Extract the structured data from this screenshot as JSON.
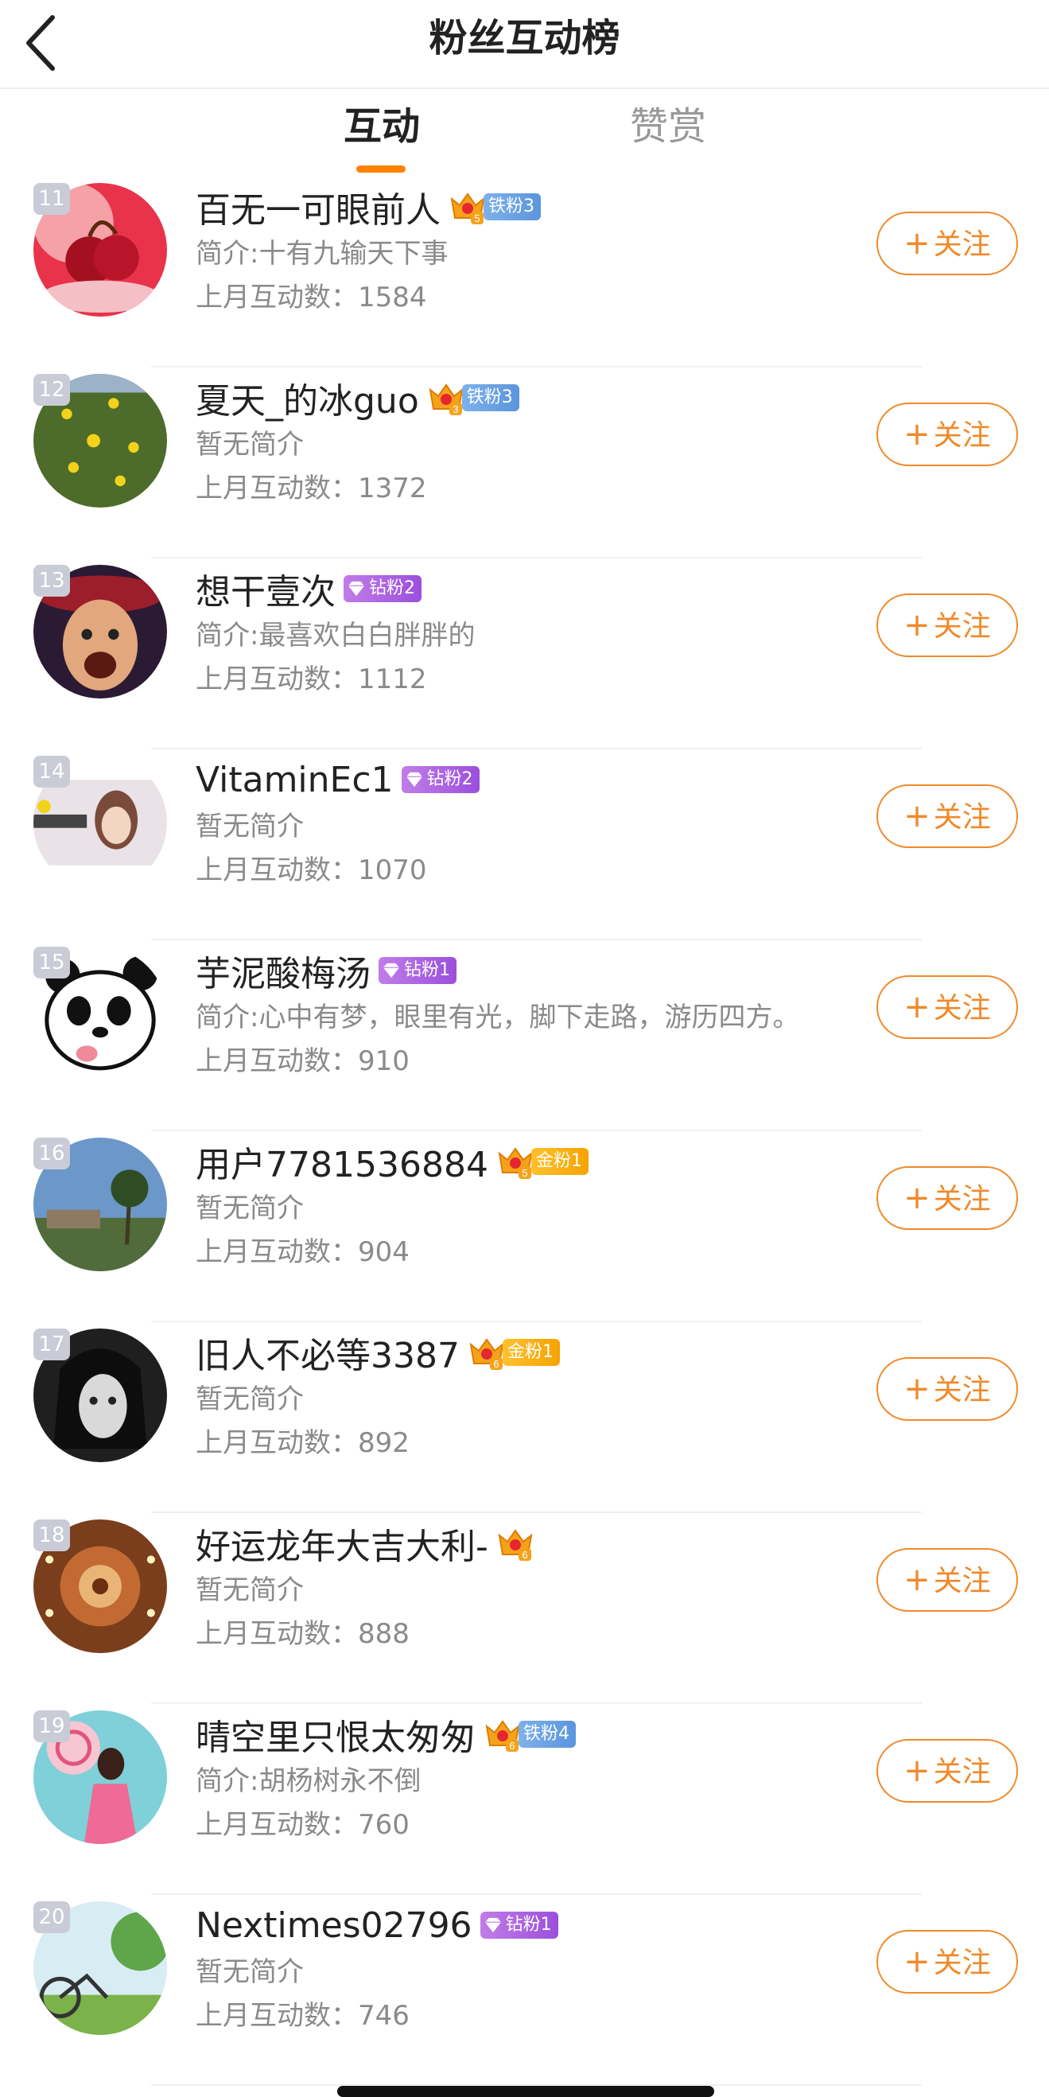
{
  "header": {
    "title": "粉丝互动榜"
  },
  "tabs": [
    {
      "label": "互动",
      "active": true
    },
    {
      "label": "赞赏",
      "active": false
    }
  ],
  "colors": {
    "accent": "#ff8200",
    "follow": "#f0892a",
    "iron_badge": "#6aa3e4",
    "gold_badge": "#fbb318",
    "diamond_badge": "#ad63e2"
  },
  "users": [
    {
      "rank": "11",
      "name": "百无一可眼前人",
      "crown_level": "5",
      "badge": "铁粉3",
      "badge_type": "iron",
      "intro": "简介:十有九输天下事",
      "stat": "上月互动数：1584",
      "follow": "关注"
    },
    {
      "rank": "12",
      "name": "夏天_的冰guo",
      "crown_level": "3",
      "badge": "铁粉3",
      "badge_type": "iron",
      "intro": "暂无简介",
      "stat": "上月互动数：1372",
      "follow": "关注"
    },
    {
      "rank": "13",
      "name": "想干壹次",
      "crown_level": "",
      "badge": "钻粉2",
      "badge_type": "diamond",
      "intro": "简介:最喜欢白白胖胖的",
      "stat": "上月互动数：1112",
      "follow": "关注"
    },
    {
      "rank": "14",
      "name": "VitaminEc1",
      "crown_level": "",
      "badge": "钻粉2",
      "badge_type": "diamond",
      "intro": "暂无简介",
      "stat": "上月互动数：1070",
      "follow": "关注"
    },
    {
      "rank": "15",
      "name": "芋泥酸梅汤",
      "crown_level": "",
      "badge": "钻粉1",
      "badge_type": "diamond",
      "intro": "简介:心中有梦，眼里有光，脚下走路，游历四方。",
      "stat": "上月互动数：910",
      "follow": "关注"
    },
    {
      "rank": "16",
      "name": "用户7781536884",
      "crown_level": "5",
      "badge": "金粉1",
      "badge_type": "gold",
      "intro": "暂无简介",
      "stat": "上月互动数：904",
      "follow": "关注"
    },
    {
      "rank": "17",
      "name": "旧人不必等3387",
      "crown_level": "6",
      "badge": "金粉1",
      "badge_type": "gold",
      "intro": "暂无简介",
      "stat": "上月互动数：892",
      "follow": "关注"
    },
    {
      "rank": "18",
      "name": "好运龙年大吉大利-",
      "crown_level": "6",
      "badge": "",
      "badge_type": "",
      "intro": "暂无简介",
      "stat": "上月互动数：888",
      "follow": "关注"
    },
    {
      "rank": "19",
      "name": "晴空里只恨太匆匆",
      "crown_level": "6",
      "badge": "铁粉4",
      "badge_type": "iron",
      "intro": "简介:胡杨树永不倒",
      "stat": "上月互动数：760",
      "follow": "关注"
    },
    {
      "rank": "20",
      "name": "Nextimes02796",
      "crown_level": "",
      "badge": "钻粉1",
      "badge_type": "diamond",
      "intro": "暂无简介",
      "stat": "上月互动数：746",
      "follow": "关注"
    }
  ]
}
